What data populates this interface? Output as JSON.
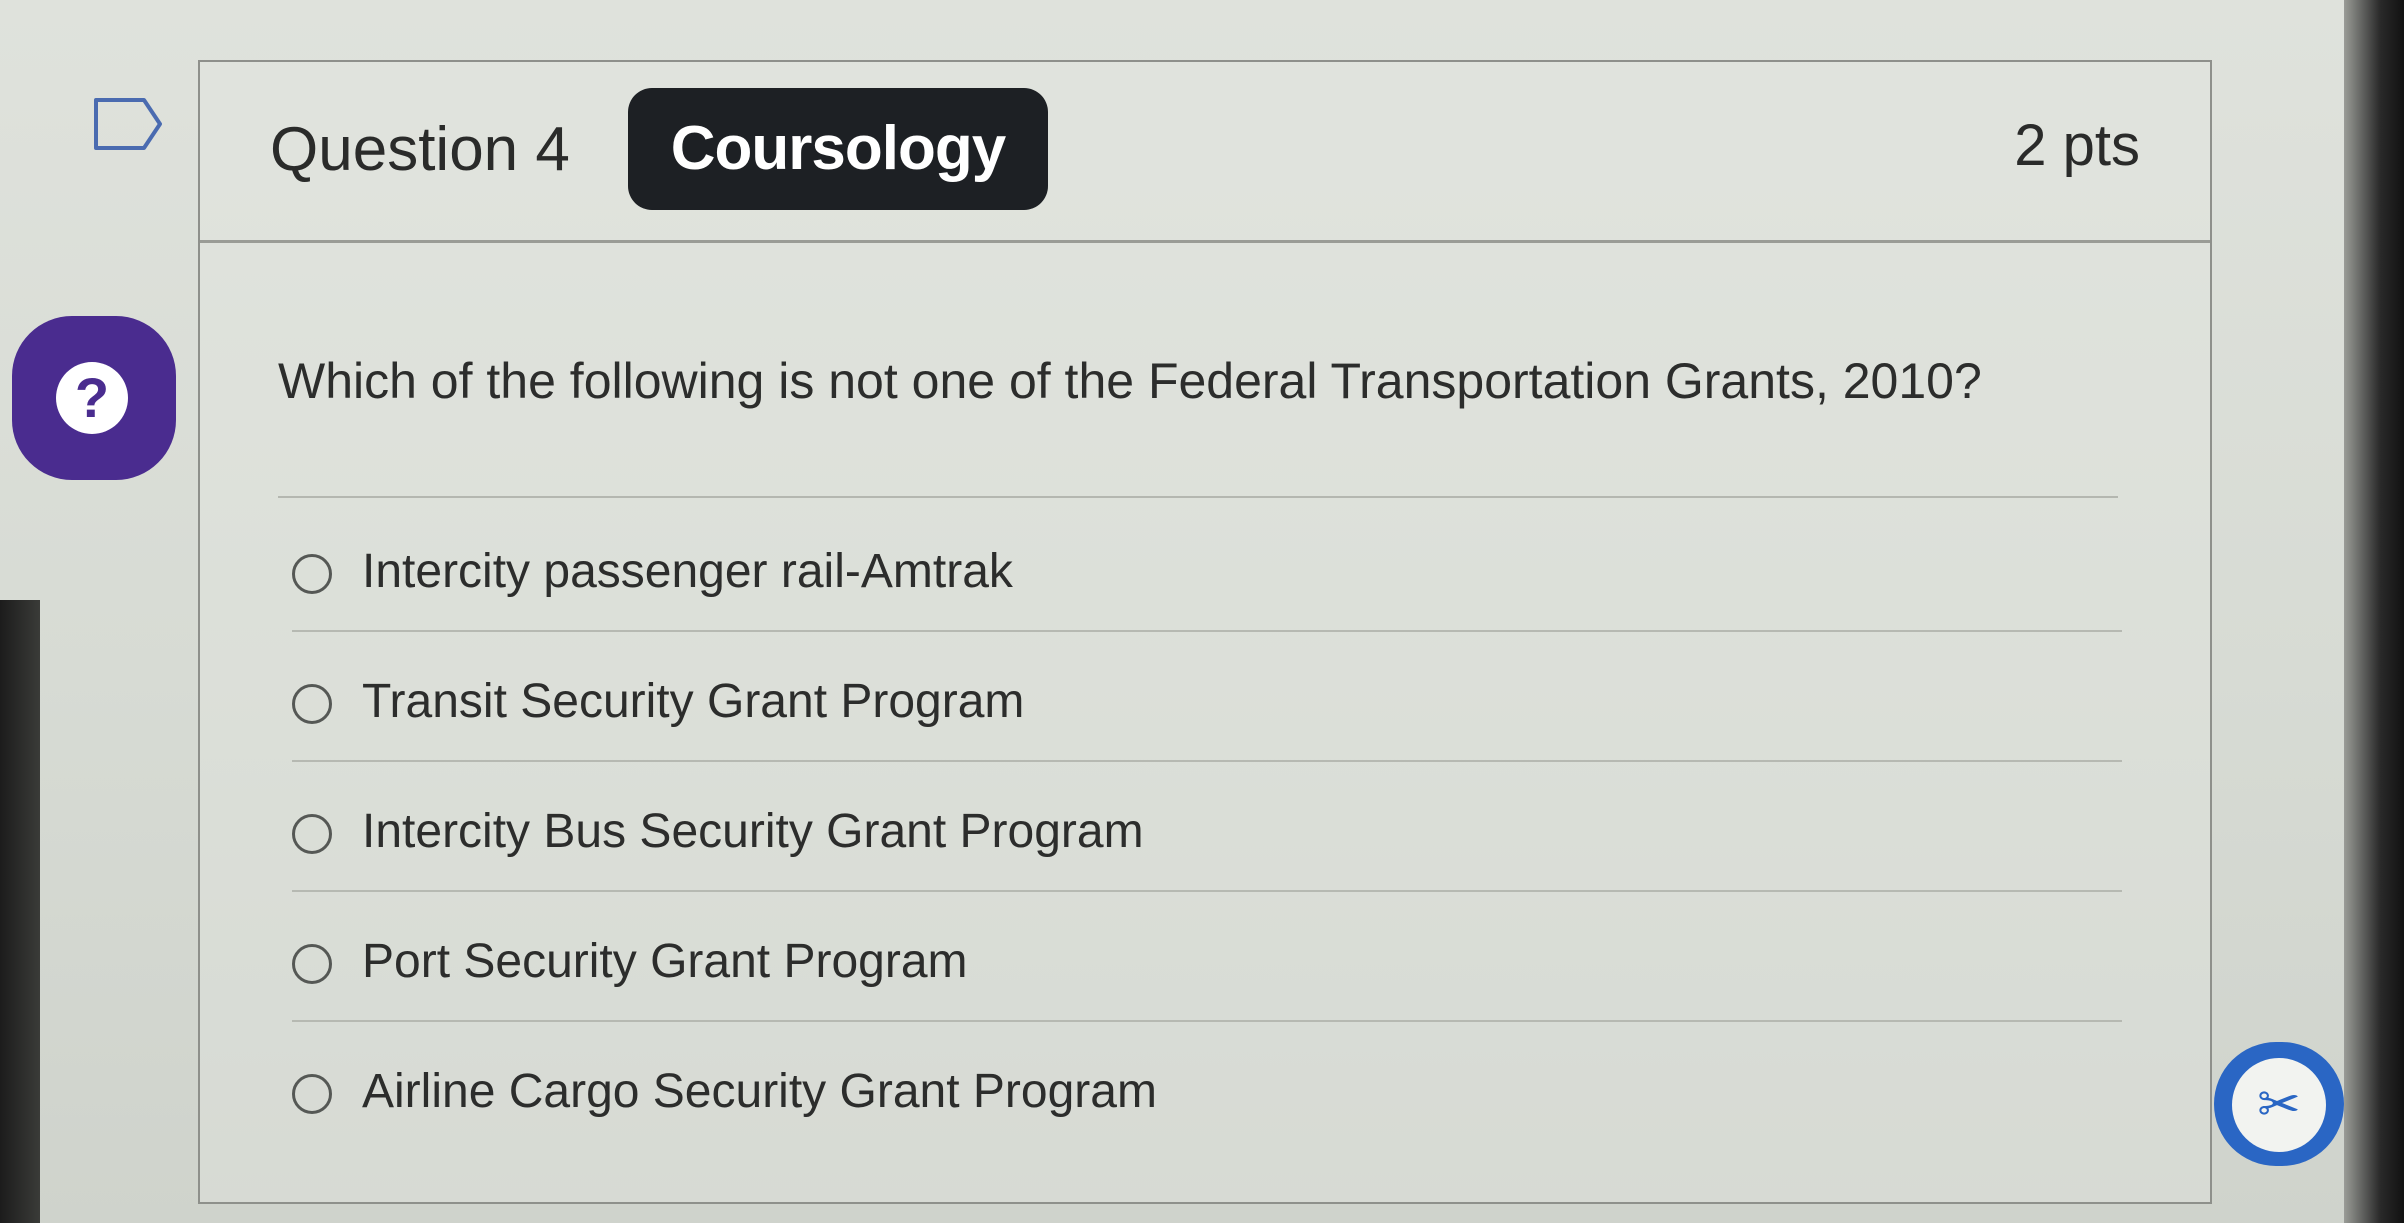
{
  "header": {
    "question_title": "Question 4",
    "brand": "Coursology",
    "points": "2 pts"
  },
  "question": {
    "prompt": "Which of the following is not one of the Federal Transportation Grants, 2010?"
  },
  "answers": [
    {
      "label": "Intercity passenger rail-Amtrak",
      "selected": false
    },
    {
      "label": "Transit Security Grant Program",
      "selected": false
    },
    {
      "label": "Intercity Bus Security Grant Program",
      "selected": false
    },
    {
      "label": "Port Security Grant Program",
      "selected": false
    },
    {
      "label": "Airline Cargo Security Grant Program",
      "selected": false
    }
  ],
  "icons": {
    "flag": "flag-icon",
    "help": "help-icon",
    "help_glyph": "?",
    "scissors": "scissors-icon",
    "scissors_glyph": "✂"
  },
  "colors": {
    "help_badge": "#4a2c8f",
    "brand_bg": "#1d2024",
    "scissor_button": "#2a66c4"
  }
}
